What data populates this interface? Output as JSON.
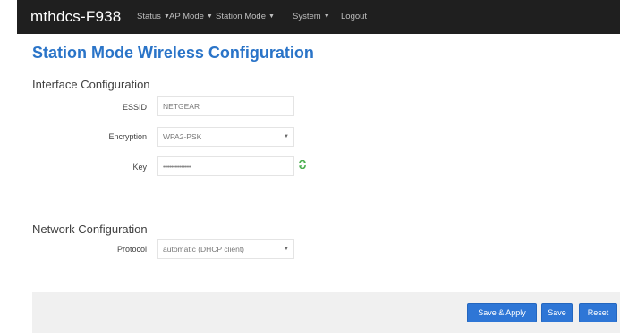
{
  "navbar": {
    "brand": "mthdcs-F938",
    "items": [
      {
        "label": "Status",
        "has_menu": true
      },
      {
        "label": "AP Mode",
        "has_menu": true
      },
      {
        "label": "Station Mode",
        "has_menu": true
      },
      {
        "label": "System",
        "has_menu": true
      },
      {
        "label": "Logout",
        "has_menu": false
      }
    ],
    "caret": "▼"
  },
  "page": {
    "title": "Station Mode Wireless Configuration"
  },
  "interface": {
    "heading": "Interface Configuration",
    "essid": {
      "label": "ESSID",
      "value": "NETGEAR"
    },
    "encryption": {
      "label": "Encryption",
      "value": "WPA2-PSK"
    },
    "key": {
      "label": "Key",
      "value": "•••••••••••••••••"
    }
  },
  "network": {
    "heading": "Network Configuration",
    "protocol": {
      "label": "Protocol",
      "value": "automatic (DHCP client)"
    }
  },
  "actions": {
    "save_apply": "Save & Apply",
    "save": "Save",
    "reset": "Reset"
  },
  "icons": {
    "reveal_key": "refresh-arrows-icon",
    "select_caret": "caret-down-icon"
  },
  "colors": {
    "title": "#2a74c8",
    "button": "#2e76d6",
    "navbar": "#1f1f1f",
    "reveal_icon": "#4caf50"
  }
}
